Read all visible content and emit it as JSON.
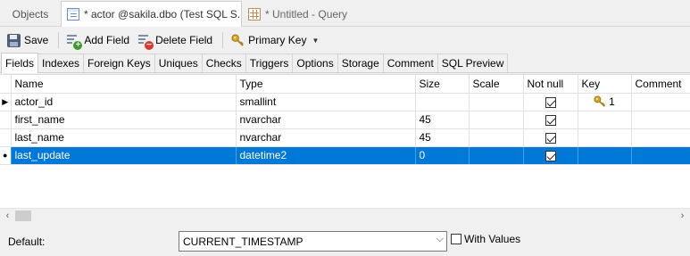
{
  "doc_tabs": {
    "objects": "Objects",
    "actor": "* actor @sakila.dbo (Test SQL S...",
    "query": "* Untitled - Query"
  },
  "toolbar": {
    "save": "Save",
    "add_field": "Add Field",
    "delete_field": "Delete Field",
    "primary_key": "Primary Key"
  },
  "prop_tabs": [
    "Fields",
    "Indexes",
    "Foreign Keys",
    "Uniques",
    "Checks",
    "Triggers",
    "Options",
    "Storage",
    "Comment",
    "SQL Preview"
  ],
  "grid": {
    "columns": [
      "Name",
      "Type",
      "Size",
      "Scale",
      "Not null",
      "Key",
      "Comment"
    ],
    "rows": [
      {
        "name": "actor_id",
        "type": "smallint",
        "size": "",
        "scale": "",
        "not_null": true,
        "key": "1",
        "comment": ""
      },
      {
        "name": "first_name",
        "type": "nvarchar",
        "size": "45",
        "scale": "",
        "not_null": true,
        "key": "",
        "comment": ""
      },
      {
        "name": "last_name",
        "type": "nvarchar",
        "size": "45",
        "scale": "",
        "not_null": true,
        "key": "",
        "comment": ""
      },
      {
        "name": "last_update",
        "type": "datetime2",
        "size": "0",
        "scale": "",
        "not_null": true,
        "key": "",
        "comment": ""
      }
    ]
  },
  "default": {
    "label": "Default:",
    "value": "CURRENT_TIMESTAMP",
    "with_values_label": "With Values",
    "with_values_checked": false
  },
  "colors": {
    "selection": "#0078d7",
    "key_gold": "#d9a520"
  }
}
